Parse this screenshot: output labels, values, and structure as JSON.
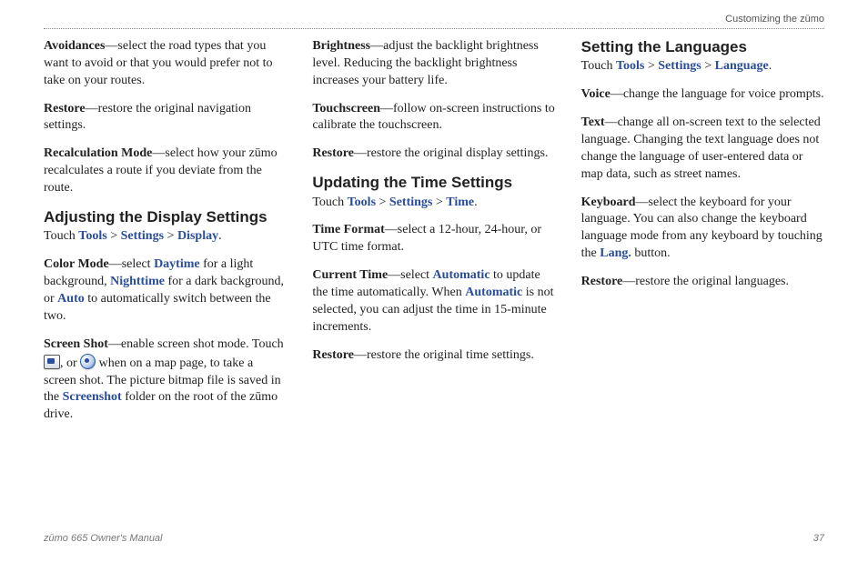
{
  "header": {
    "right": "Customizing the zūmo"
  },
  "footer": {
    "left": "zūmo 665 Owner's Manual",
    "page": "37"
  },
  "c1": {
    "avoidances_t": "Avoidances",
    "avoidances_b": "—select the road types that you want to avoid or that you would prefer not to take on your routes.",
    "restore_t": "Restore",
    "restore_b": "—restore the original navigation settings.",
    "recalc_t": "Recalculation Mode",
    "recalc_b": "—select how your zūmo recalculates a route if you deviate from the route.",
    "h_display": "Adjusting the Display Settings",
    "touch": "Touch ",
    "tools": "Tools",
    "gt": " > ",
    "settings": "Settings",
    "display": "Display",
    "dot": ".",
    "color_t": "Color Mode",
    "color_b1": "—select ",
    "daytime": "Daytime",
    "color_b2": " for a light background, ",
    "nighttime": "Nighttime",
    "color_b3": " for a dark background, or ",
    "auto": "Auto",
    "color_b4": " to automatically switch between the two.",
    "ss_t": "Screen Shot",
    "ss_b1": "—enable screen shot mode. Touch ",
    "ss_or": ", or ",
    "ss_b2": " when on a map page, to take a screen shot. The picture bitmap file is saved in the ",
    "ss_folder": "Screenshot",
    "ss_b3": " folder on the root of the zūmo drive."
  },
  "c2": {
    "bright_t": "Brightness",
    "bright_b": "—adjust the backlight brightness level. Reducing the backlight brightness increases your battery life.",
    "touchscreen_t": "Touchscreen",
    "touchscreen_b": "—follow on-screen instructions to calibrate the touchscreen.",
    "restore_t": "Restore",
    "restore_b": "—restore the original display settings.",
    "h_time": "Updating the Time Settings",
    "touch": "Touch ",
    "tools": "Tools",
    "gt": " > ",
    "settings": "Settings",
    "time": "Time",
    "dot": ".",
    "tf_t": "Time Format",
    "tf_b": "—select a 12-hour, 24-hour, or UTC time format.",
    "ct_t": "Current Time",
    "ct_b1": "—select ",
    "automatic": "Automatic",
    "ct_b2": " to update the time automatically. When ",
    "ct_b3": " is not selected, you can adjust the time in 15-minute increments.",
    "restore2_t": "Restore",
    "restore2_b": "—restore the original time settings."
  },
  "c3": {
    "h_lang": "Setting the Languages",
    "touch": "Touch ",
    "tools": "Tools",
    "gt": " > ",
    "settings": "Settings",
    "language": "Language",
    "dot": ".",
    "voice_t": "Voice",
    "voice_b": "—change the language for voice prompts.",
    "text_t": "Text",
    "text_b": "—change all on-screen text to the selected language. Changing the text language does not change the language of user-entered data or map data, such as street names.",
    "kb_t": "Keyboard",
    "kb_b1": "—select the keyboard for your language. You can also change the keyboard language mode from any keyboard by touching the ",
    "lang": "Lang.",
    "kb_b2": " button.",
    "restore_t": "Restore",
    "restore_b": "—restore the original languages."
  }
}
